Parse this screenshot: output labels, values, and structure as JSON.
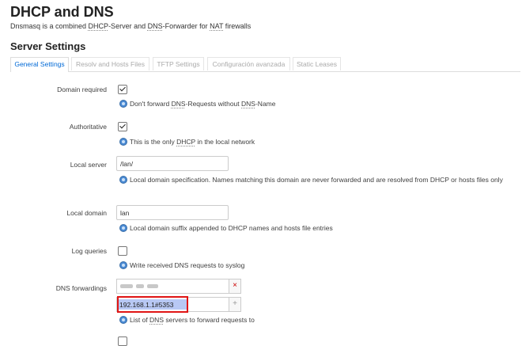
{
  "page": {
    "title": "DHCP and DNS",
    "description": {
      "pre": "Dnsmasq is a combined ",
      "dhcp": "DHCP",
      "mid1": "-Server and ",
      "dns": "DNS",
      "mid2": "-Forwarder for ",
      "nat": "NAT",
      "post": " firewalls"
    },
    "section_title": "Server Settings"
  },
  "tabs": [
    {
      "label": "General Settings",
      "active": true
    },
    {
      "label": "Resolv and Hosts Files",
      "active": false
    },
    {
      "label": "TFTP Settings",
      "active": false
    },
    {
      "label": "Configuración avanzada",
      "active": false
    },
    {
      "label": "Static Leases",
      "active": false
    }
  ],
  "fields": {
    "domain_required": {
      "label": "Domain required",
      "checked": true,
      "help": {
        "pre": "Don't forward ",
        "dns1": "DNS",
        "mid": "-Requests without ",
        "dns2": "DNS",
        "post": "-Name"
      }
    },
    "authoritative": {
      "label": "Authoritative",
      "checked": true,
      "help": {
        "pre": "This is the only ",
        "dhcp": "DHCP",
        "post": " in the local network"
      }
    },
    "local_server": {
      "label": "Local server",
      "value": "/lan/",
      "help": "Local domain specification. Names matching this domain are never forwarded and are resolved from DHCP or hosts files only"
    },
    "local_domain": {
      "label": "Local domain",
      "value": "lan",
      "help": "Local domain suffix appended to DHCP names and hosts file entries"
    },
    "log_queries": {
      "label": "Log queries",
      "checked": false,
      "help": "Write received DNS requests to syslog"
    },
    "dns_forwardings": {
      "label": "DNS forwardings",
      "remove_symbol": "×",
      "add_symbol": "+",
      "new_value": "192.168.1.1#5353",
      "help": {
        "pre": "List of ",
        "dns": "DNS",
        "post": " servers to forward requests to"
      }
    }
  },
  "colors": {
    "accent": "#0069d6",
    "highlight": "#e01515"
  }
}
